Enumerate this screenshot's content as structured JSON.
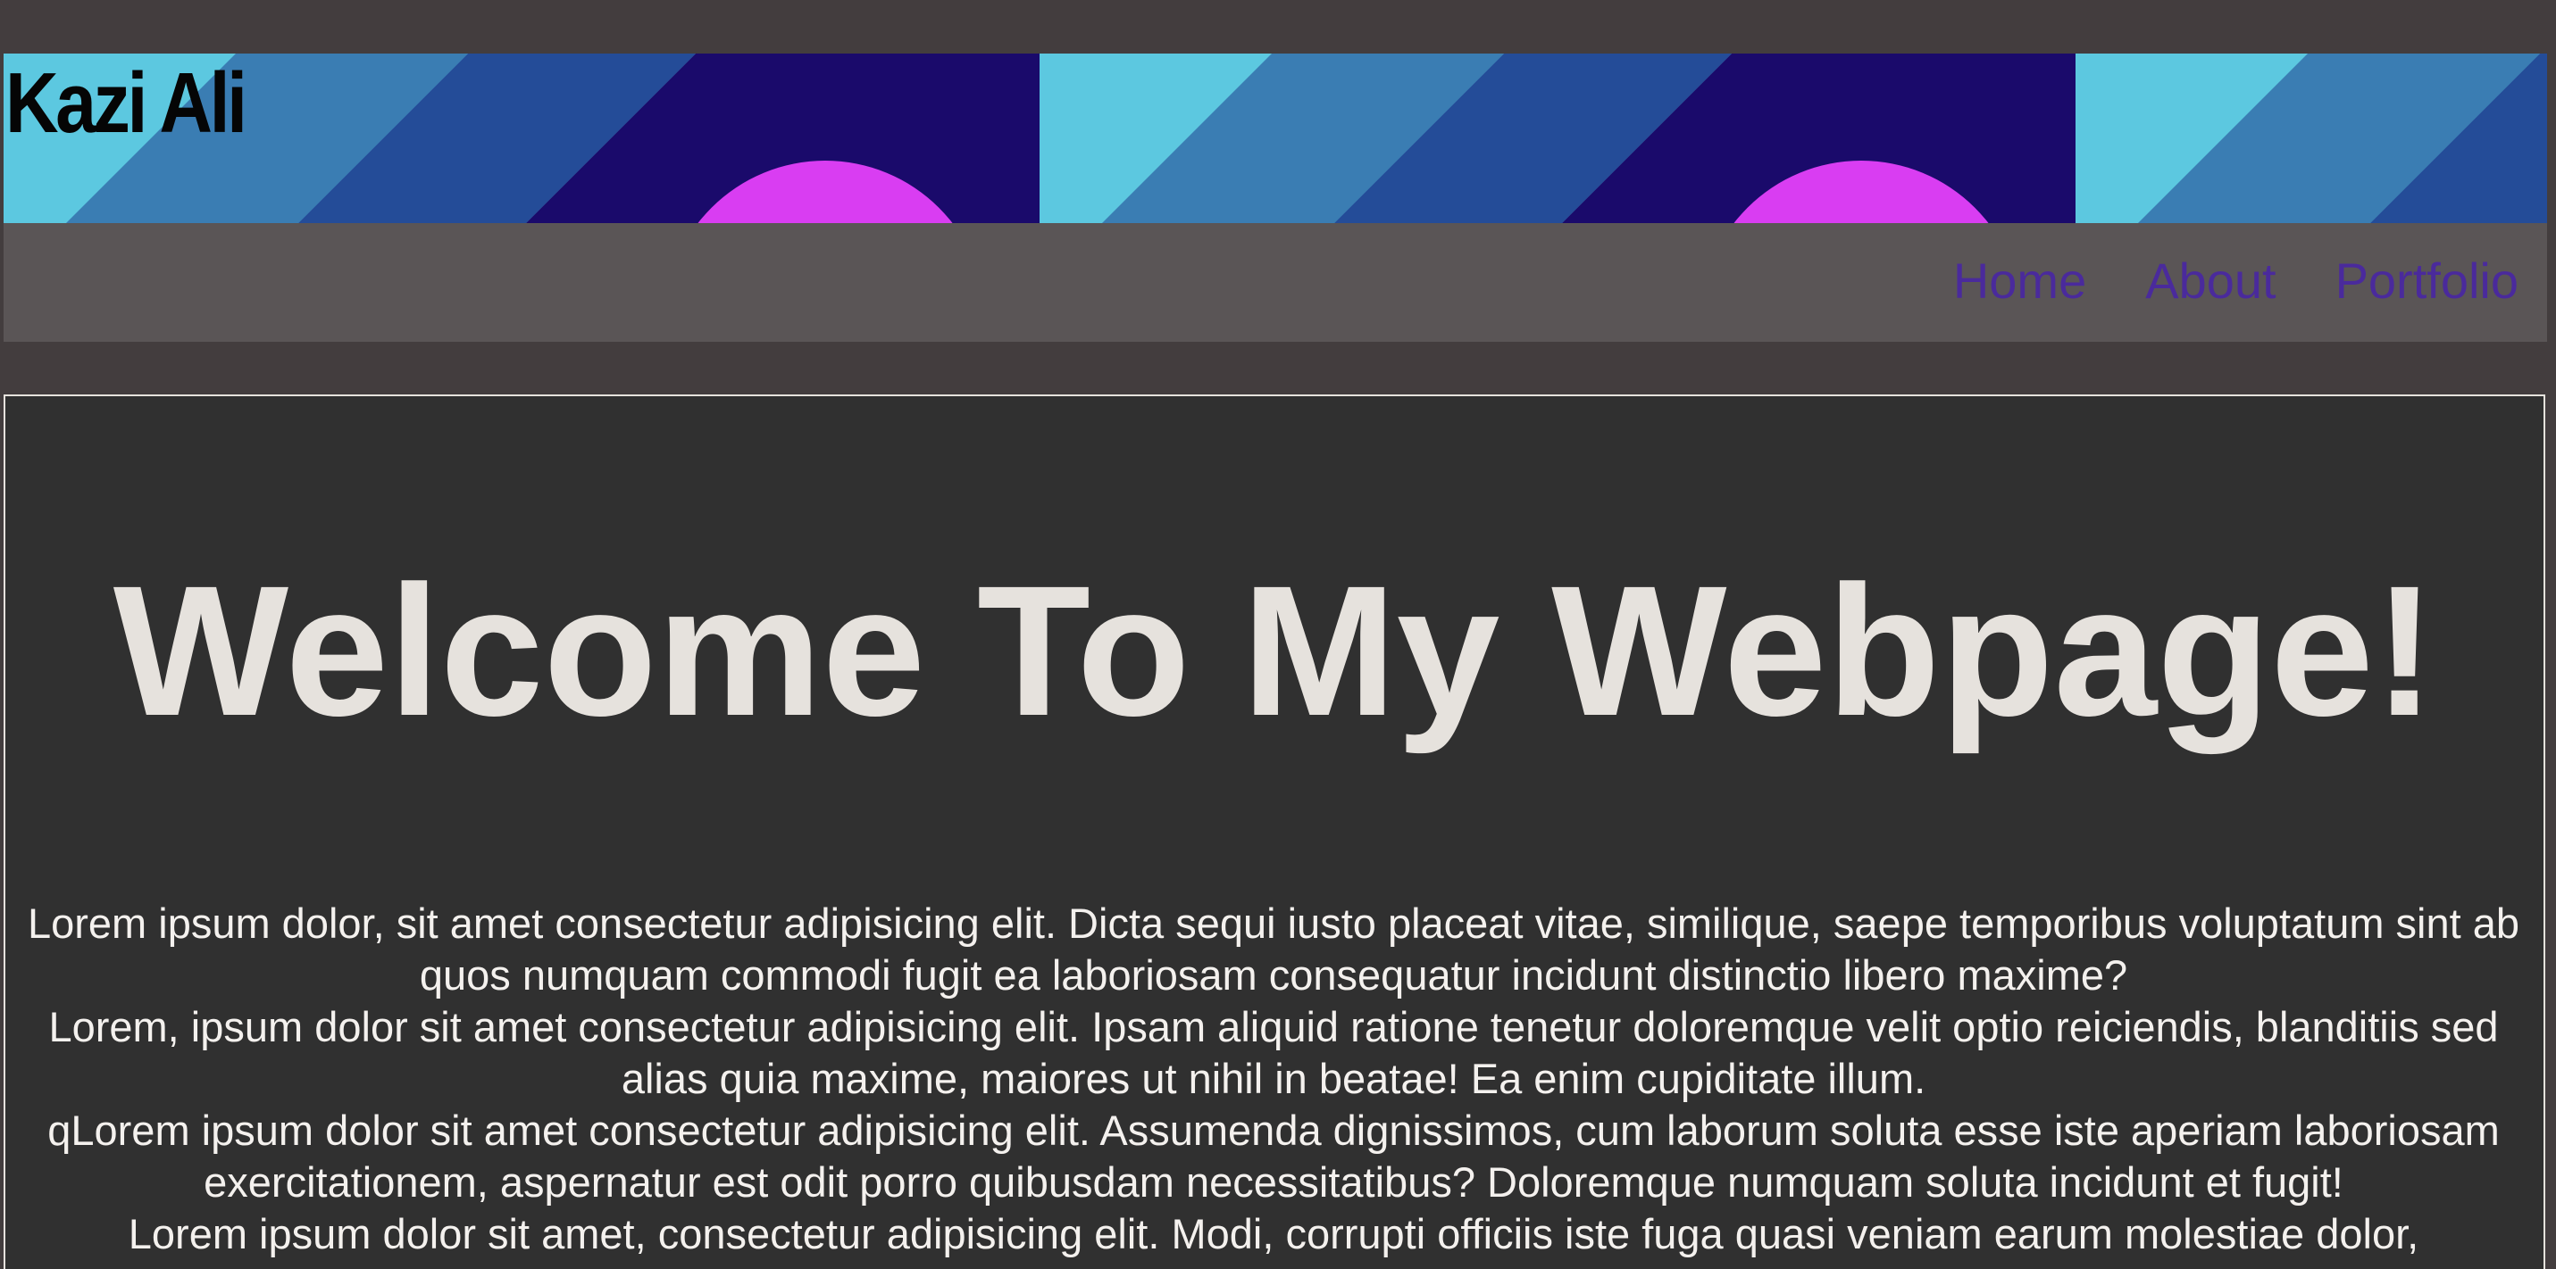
{
  "header": {
    "site_title": "Kazi Ali",
    "banner_colors": [
      "#5cc8e0",
      "#3a7db3",
      "#244c98",
      "#1a0a6b",
      "#d93df2"
    ]
  },
  "nav": {
    "items": [
      {
        "label": "Home"
      },
      {
        "label": "About"
      },
      {
        "label": "Portfolio"
      }
    ],
    "link_color": "#4a2a9c"
  },
  "main": {
    "headline": "Welcome To My Webpage!",
    "paragraphs": [
      "Lorem ipsum dolor, sit amet consectetur adipisicing elit. Dicta sequi iusto placeat vitae, similique, saepe temporibus voluptatum sint ab quos numquam commodi fugit ea laboriosam consequatur incidunt distinctio libero maxime?",
      "Lorem, ipsum dolor sit amet consectetur adipisicing elit. Ipsam aliquid ratione tenetur doloremque velit optio reiciendis, blanditiis sed alias quia maxime, maiores ut nihil in beatae! Ea enim cupiditate illum.",
      "qLorem ipsum dolor sit amet consectetur adipisicing elit. Assumenda dignissimos, cum laborum soluta esse iste aperiam laboriosam exercitationem, aspernatur est odit porro quibusdam necessitatibus? Doloremque numquam soluta incidunt et fugit!",
      "Lorem ipsum dolor sit amet, consectetur adipisicing elit. Modi, corrupti officiis iste fuga quasi veniam earum molestiae dolor,"
    ]
  }
}
